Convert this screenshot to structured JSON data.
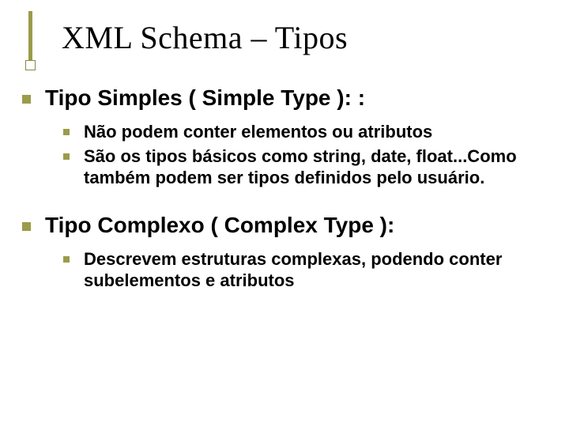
{
  "title": "XML Schema – Tipos",
  "section1": {
    "heading_strong": "Tipo Simples",
    "heading_paren": " ( Simple Type ): :",
    "items": [
      "Não podem conter elementos ou atributos",
      "São os tipos básicos como string, date, float...Como também podem ser tipos definidos pelo usuário."
    ]
  },
  "section2": {
    "heading": "Tipo Complexo ( Complex Type ):",
    "items": [
      "Descrevem estruturas complexas, podendo conter subelementos e atributos"
    ]
  }
}
